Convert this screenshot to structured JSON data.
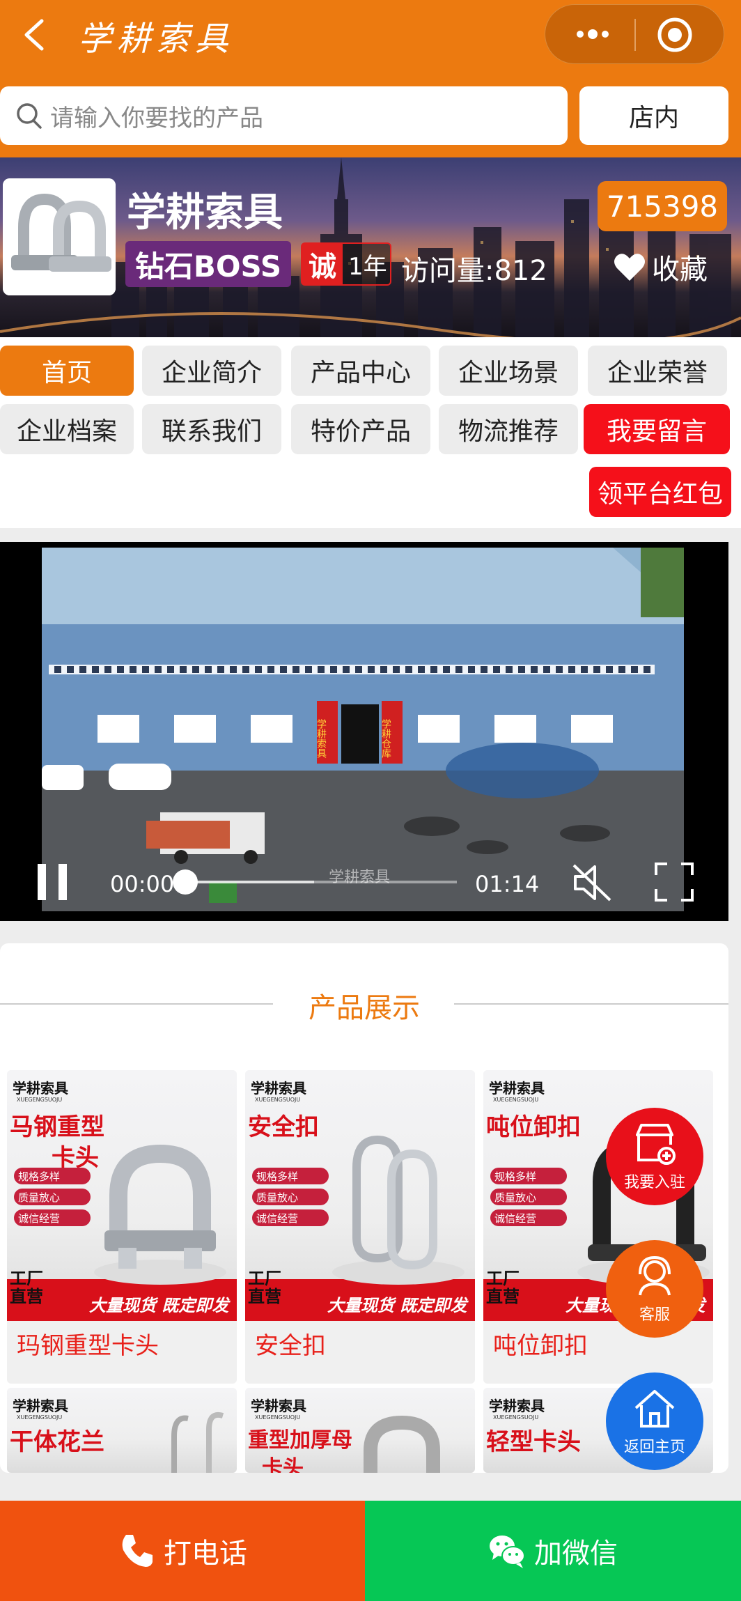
{
  "app": {
    "title": "学耕索具"
  },
  "search": {
    "placeholder": "请输入你要找的产品",
    "store_button": "店内"
  },
  "shop": {
    "name": "学耕索具",
    "id": "715398",
    "membership": "钻石BOSS",
    "cheng_label": "诚",
    "years": "1年",
    "visits": "访问量:812",
    "favorite": "收藏"
  },
  "nav": {
    "items": [
      "首页",
      "企业简介",
      "产品中心",
      "企业场景",
      "企业荣誉",
      "企业档案",
      "联系我们",
      "特价产品",
      "物流推荐",
      "我要留言",
      "领平台红包"
    ],
    "active": "首页"
  },
  "video": {
    "current_time": "00:00",
    "duration": "01:14",
    "watermark": "学耕索具",
    "progress": 0.0,
    "building_sign_left": "学耕索具",
    "building_sign_right": "学耕仓库"
  },
  "products": {
    "section_title": "产品展示",
    "items": [
      {
        "name": "玛钢重型卡头",
        "img_brand": "学耕索具",
        "img_brand_sub": "XUEGENGSUOJU",
        "img_title_1": "马钢重型",
        "img_title_2": "卡头",
        "tags": [
          "规格多样",
          "质量放心",
          "诚信经营"
        ],
        "factory_1": "工厂",
        "factory_2": "直营",
        "banner": "大量现货 既定即发"
      },
      {
        "name": "安全扣",
        "img_brand": "学耕索具",
        "img_brand_sub": "XUEGENGSUOJU",
        "img_title_1": "安全扣",
        "img_title_2": "",
        "tags": [
          "规格多样",
          "质量放心",
          "诚信经营"
        ],
        "factory_1": "工厂",
        "factory_2": "直营",
        "banner": "大量现货 既定即发"
      },
      {
        "name": "吨位卸扣",
        "img_brand": "学耕索具",
        "img_brand_sub": "XUEGENGSUOJU",
        "img_title_1": "吨位卸扣",
        "img_title_2": "",
        "tags": [
          "规格多样",
          "质量放心",
          "诚信经营"
        ],
        "factory_1": "工厂",
        "factory_2": "直营",
        "banner": "大量现货 既定即发"
      },
      {
        "img_brand": "学耕索具",
        "img_brand_sub": "XUEGENGSUOJU",
        "img_title_1": "干体花兰"
      },
      {
        "img_brand": "学耕索具",
        "img_brand_sub": "XUEGENGSUOJU",
        "img_title_1": "重型加厚母",
        "img_title_2": "卡头"
      },
      {
        "img_brand": "学耕索具",
        "img_brand_sub": "XUEGENGSUOJU",
        "img_title_1": "轻型卡头"
      }
    ]
  },
  "floating": {
    "join": "我要入驻",
    "service": "客服",
    "home": "返回主页"
  },
  "bottom": {
    "call": "打电话",
    "wechat": "加微信"
  },
  "colors": {
    "brand_orange": "#ec7a10",
    "nav_red": "#f5101a",
    "call_orange": "#f0520f",
    "wechat_green": "#06c755",
    "join_red": "#e8101a",
    "service_orange": "#f0600f",
    "home_blue": "#1a72e6"
  }
}
